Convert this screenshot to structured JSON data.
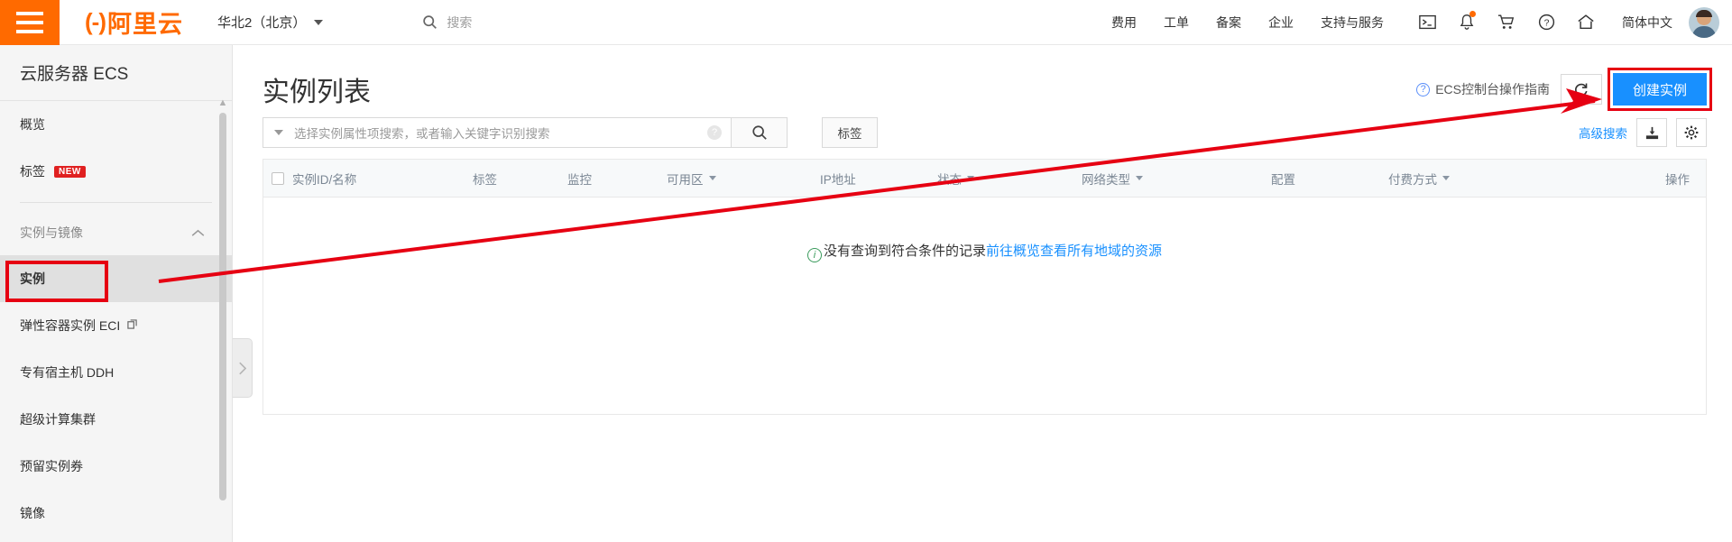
{
  "header": {
    "logo_text": "阿里云",
    "logo_mark": "(-)",
    "region": "华北2（北京）",
    "search_placeholder": "搜索",
    "nav": [
      {
        "label": "费用"
      },
      {
        "label": "工单"
      },
      {
        "label": "备案"
      },
      {
        "label": "企业"
      },
      {
        "label": "支持与服务"
      }
    ],
    "icons": [
      {
        "name": "terminal-icon",
        "glyph": "▣"
      },
      {
        "name": "bell-icon",
        "glyph": "🔔"
      },
      {
        "name": "cart-icon",
        "glyph": "🛒"
      },
      {
        "name": "help-icon",
        "glyph": "?"
      },
      {
        "name": "home-icon",
        "glyph": "⌂"
      }
    ],
    "language": "简体中文"
  },
  "sidebar": {
    "title": "云服务器 ECS",
    "top_items": [
      {
        "label": "概览",
        "badge": ""
      },
      {
        "label": "标签",
        "badge": "NEW"
      }
    ],
    "group_label": "实例与镜像",
    "items": [
      {
        "label": "实例",
        "active": true,
        "external": false
      },
      {
        "label": "弹性容器实例 ECI",
        "active": false,
        "external": true
      },
      {
        "label": "专有宿主机 DDH",
        "active": false,
        "external": false
      },
      {
        "label": "超级计算集群",
        "active": false,
        "external": false
      },
      {
        "label": "预留实例券",
        "active": false,
        "external": false
      },
      {
        "label": "镜像",
        "active": false,
        "external": false
      }
    ]
  },
  "main": {
    "page_title": "实例列表",
    "guide_link": "ECS控制台操作指南",
    "refresh_label": "⟳",
    "create_button": "创建实例",
    "search": {
      "placeholder": "选择实例属性项搜索，或者输入关键字识别搜索",
      "value": "",
      "help_glyph": "?",
      "search_glyph": "🔍"
    },
    "tag_button": "标签",
    "advanced_search": "高级搜索",
    "export_icon": "⎙",
    "settings_icon": "⚙",
    "table": {
      "columns": [
        {
          "label": "实例ID/名称",
          "sortable": false
        },
        {
          "label": "标签",
          "sortable": false
        },
        {
          "label": "监控",
          "sortable": false
        },
        {
          "label": "可用区",
          "sortable": true
        },
        {
          "label": "IP地址",
          "sortable": false
        },
        {
          "label": "状态",
          "sortable": true
        },
        {
          "label": "网络类型",
          "sortable": true
        },
        {
          "label": "配置",
          "sortable": false
        },
        {
          "label": "付费方式",
          "sortable": true
        },
        {
          "label": "操作",
          "sortable": false
        }
      ],
      "empty_text": "没有查询到符合条件的记录",
      "empty_link": "前往概览查看所有地域的资源"
    }
  },
  "annotation": {
    "color": "#e60012",
    "highlight_sidebar_item": "实例",
    "highlight_button": "创建实例"
  }
}
